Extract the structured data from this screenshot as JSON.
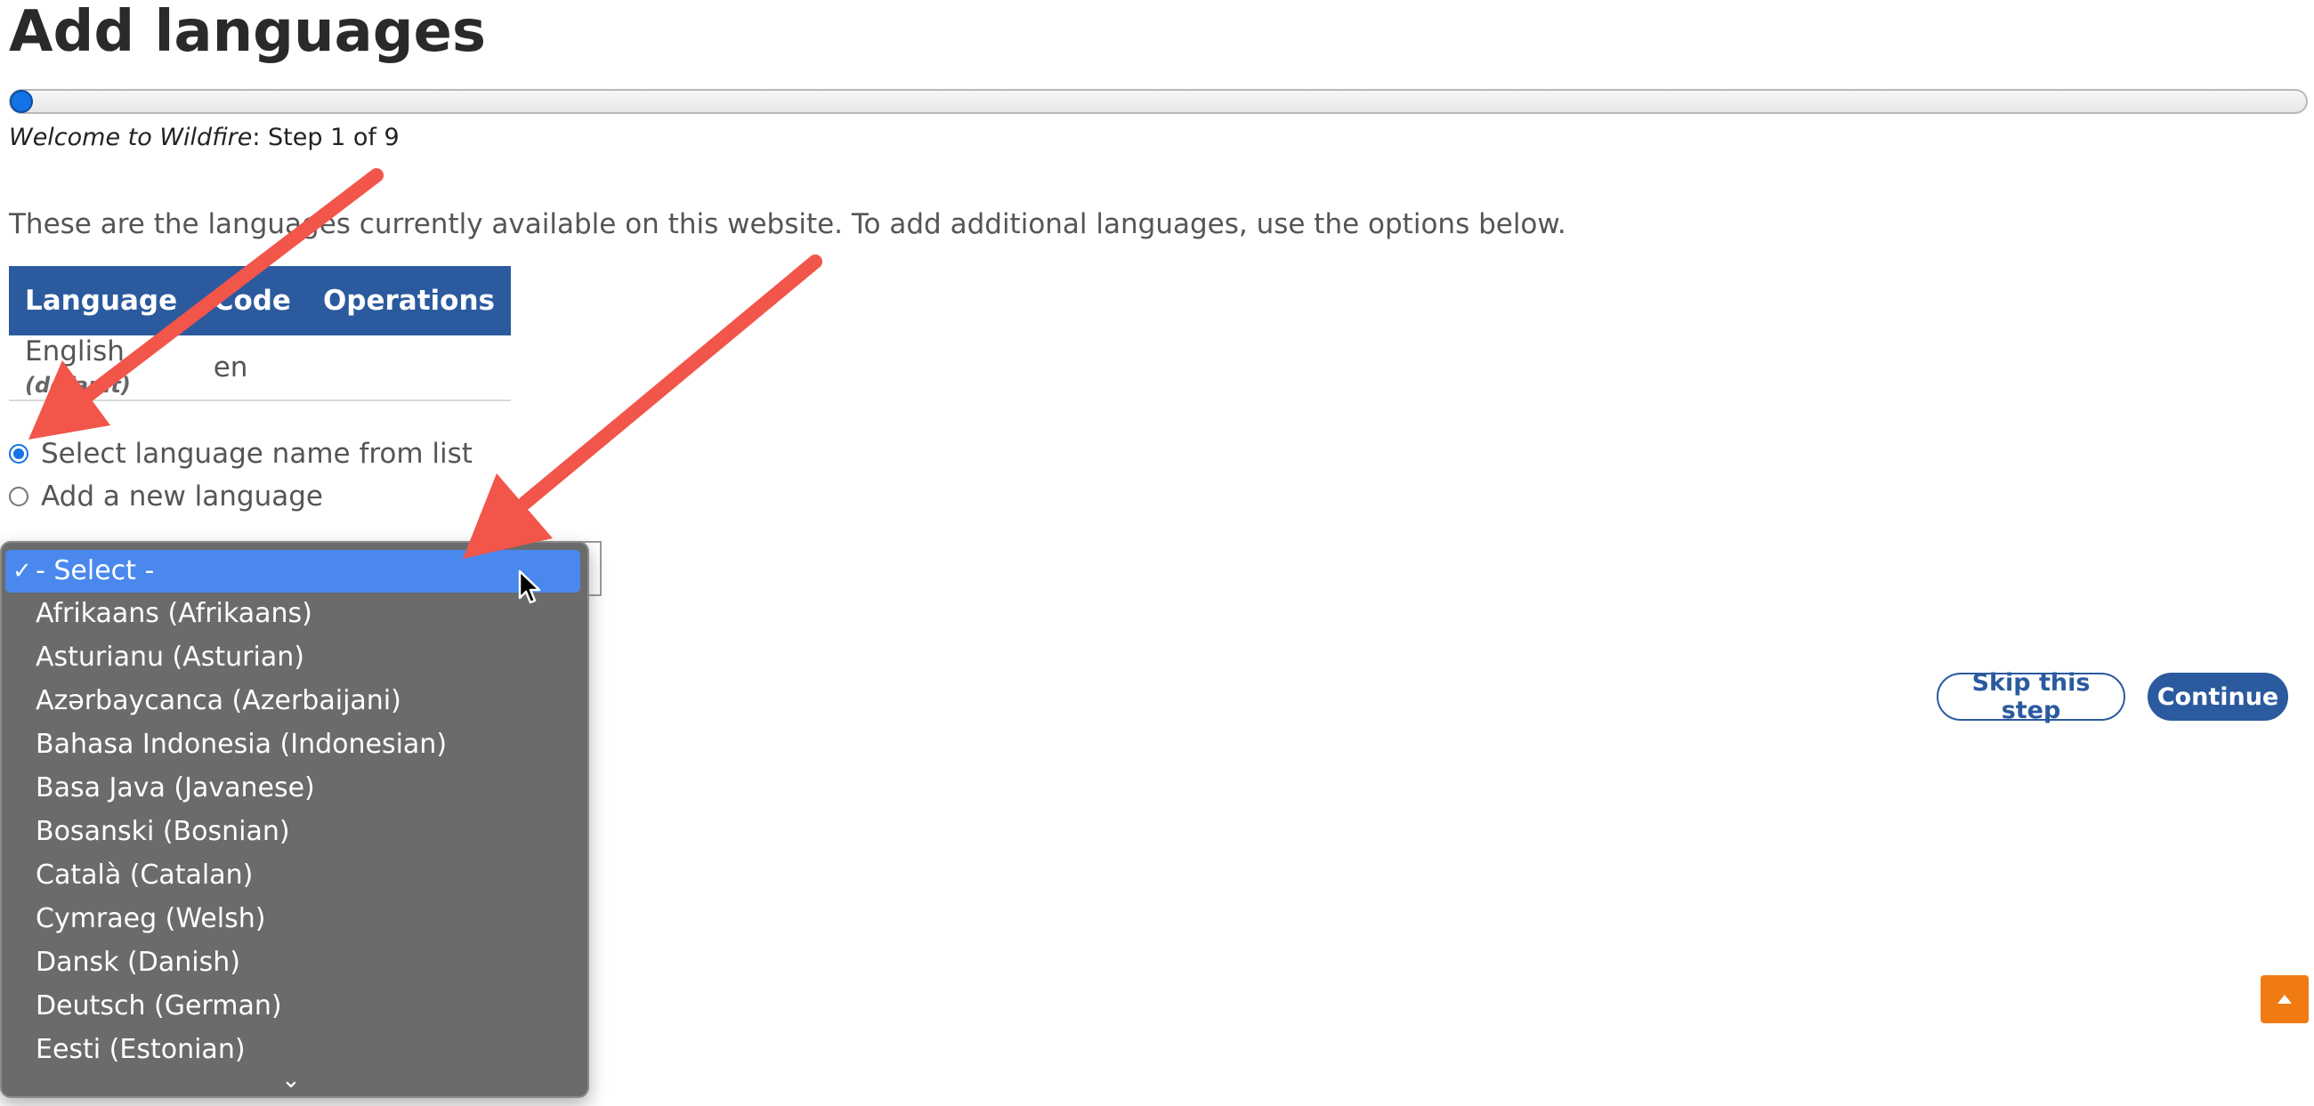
{
  "page": {
    "title": "Add languages"
  },
  "progress": {
    "fraction": 0.0,
    "step_prefix": "Welcome to Wildfire",
    "step_suffix": ": Step 1 of 9"
  },
  "intro": "These are the languages currently available on this website. To add additional languages, use the options below.",
  "table": {
    "headers": {
      "language": "Language",
      "code": "Code",
      "operations": "Operations"
    },
    "rows": [
      {
        "language": "English",
        "default_tag": "(default)",
        "code": "en",
        "operations": ""
      }
    ]
  },
  "radios": {
    "select_from_list": {
      "label": "Select language name from list",
      "checked": true
    },
    "add_new": {
      "label": "Add a new language",
      "checked": false
    }
  },
  "dropdown": {
    "selected": "- Select -",
    "check_mark": "✓",
    "options": [
      "Afrikaans (Afrikaans)",
      "Asturianu (Asturian)",
      "Azərbaycanca (Azerbaijani)",
      "Bahasa Indonesia (Indonesian)",
      "Basa Java (Javanese)",
      "Bosanski (Bosnian)",
      "Català (Catalan)",
      "Cymraeg (Welsh)",
      "Dansk (Danish)",
      "Deutsch (German)",
      "Eesti (Estonian)"
    ],
    "scroll_indicator": "⌄"
  },
  "buttons": {
    "skip": "Skip this step",
    "continue": "Continue"
  },
  "colors": {
    "primary": "#2b5a9e",
    "accent_blue": "#1473e6",
    "annotation_arrow": "#f2554a",
    "back_to_top": "#f07b12"
  },
  "icons": {
    "back_to_top": "triangle-up-icon",
    "cursor": "mouse-pointer-icon",
    "annotation": "arrow-annotation"
  }
}
